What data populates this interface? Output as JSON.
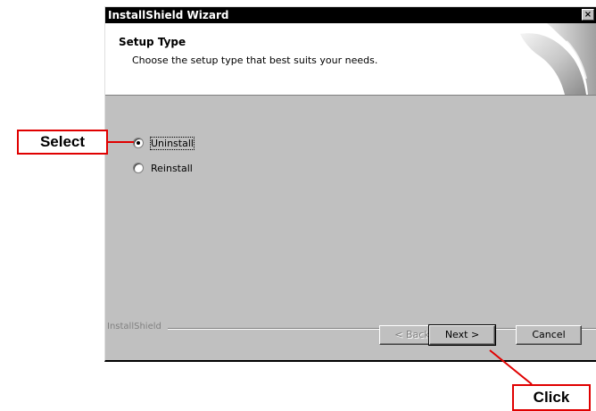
{
  "window": {
    "title": "InstallShield Wizard",
    "close_glyph": "×"
  },
  "header": {
    "title": "Setup Type",
    "subtitle": "Choose the setup type that best suits your needs."
  },
  "options": [
    {
      "label": "Uninstall",
      "selected": true
    },
    {
      "label": "Reinstall",
      "selected": false
    }
  ],
  "footer": {
    "brand": "InstallShield",
    "back_label": "< Back",
    "next_label": "Next >",
    "cancel_label": "Cancel"
  },
  "callouts": {
    "select": "Select",
    "click": "Click"
  },
  "colors": {
    "callout_border": "#e00000",
    "titlebar": "#000000",
    "dialog": "#c0c0c0"
  }
}
